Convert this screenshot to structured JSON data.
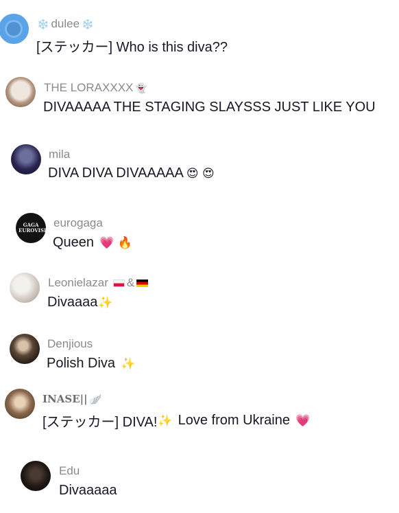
{
  "comments": [
    {
      "username": "dulee",
      "username_prefix_icon": "❄️",
      "username_suffix_icon": "❄️",
      "text": "[ステッカー] Who is this diva??",
      "text_emoji": ""
    },
    {
      "username": "THE LORAXXXX",
      "username_suffix_icon": "👻",
      "text": "DIVAAAAA THE STAGING SLAYSSS JUST LIKE YOU",
      "text_emoji": ""
    },
    {
      "username": "mila",
      "text": "DIVA DIVA DIVAAAAA",
      "text_emoji": "😍 😍"
    },
    {
      "username": "eurogaga",
      "avatar_text": "GAGA EUROVISION",
      "text": "Queen",
      "text_emoji": "💗 🔥"
    },
    {
      "username": "Leonielazar",
      "username_mid": "&",
      "text": "Divaaaa",
      "text_emoji": "✨"
    },
    {
      "username": "Denjious",
      "text": "Polish Diva",
      "text_emoji": "✨"
    },
    {
      "username": "INASE||",
      "username_suffix_icon": "🪽",
      "text": "[ステッカー] DIVA!",
      "text_emoji": "✨",
      "text_after": "Love from Ukraine",
      "text_after_emoji": "💗"
    },
    {
      "username": "Edu",
      "text": "Divaaaaa",
      "text_emoji": ""
    }
  ],
  "colors": {
    "username": "#8a8a8a",
    "text": "#161823",
    "background": "#ffffff"
  }
}
